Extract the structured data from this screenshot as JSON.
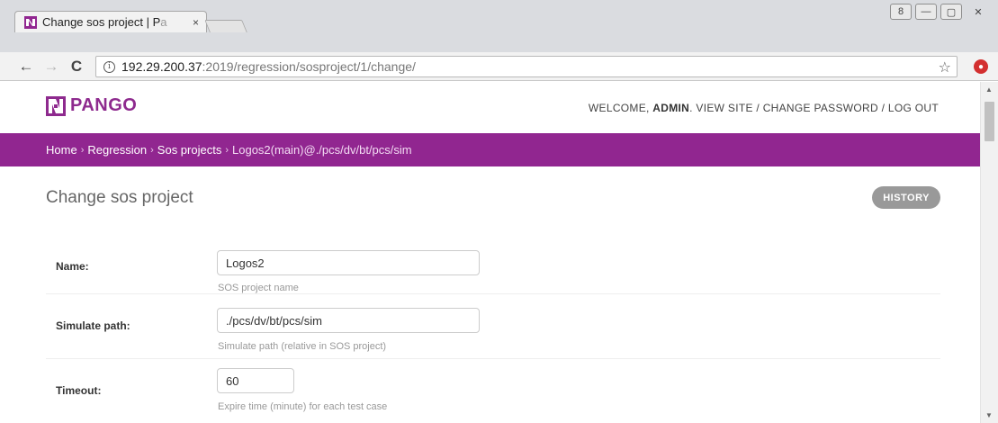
{
  "browser": {
    "tab_title": "Change sos project | P",
    "tab_title_fade": "a",
    "tab_close": "×",
    "url_host": "192.29.200.37",
    "url_path": ":2019/regression/sosproject/1/change/",
    "info_glyph": "i",
    "back_glyph": "←",
    "forward_glyph": "→",
    "reload_glyph": "C",
    "star_glyph": "☆",
    "window_controls": [
      "8",
      "—",
      "▢",
      "✕"
    ]
  },
  "header": {
    "logo_text": "PANGO",
    "welcome": "WELCOME, ",
    "username": "ADMIN",
    "after_user": ". ",
    "view_site": "VIEW SITE",
    "sep1": " / ",
    "change_password": "CHANGE PASSWORD",
    "sep2": " / ",
    "log_out": "LOG OUT",
    "brand_color": "#912690"
  },
  "breadcrumbs": {
    "home": "Home",
    "regression": "Regression",
    "sos_projects": "Sos projects",
    "current": "Logos2(main)@./pcs/dv/bt/pcs/sim",
    "separator": "›"
  },
  "main": {
    "page_title": "Change sos project",
    "history_label": "HISTORY"
  },
  "form": {
    "name": {
      "label": "Name:",
      "value": "Logos2",
      "help": "SOS project name"
    },
    "simulate_path": {
      "label": "Simulate path:",
      "value": "./pcs/dv/bt/pcs/sim",
      "help": "Simulate path (relative in SOS project)"
    },
    "timeout": {
      "label": "Timeout:",
      "value": "60",
      "help": "Expire time (minute) for each test case"
    }
  },
  "scrollbar": {
    "up_glyph": "▲",
    "down_glyph": "▼"
  }
}
